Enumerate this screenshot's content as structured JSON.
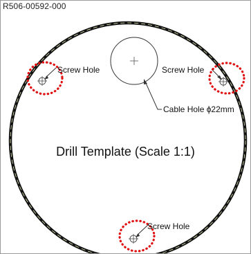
{
  "template": {
    "part_number": "R506-00592-000",
    "title": "Drill Template (Scale 1:1)"
  },
  "labels": {
    "screw_hole_left": "Screw Hole",
    "screw_hole_right": "Screw Hole",
    "screw_hole_bottom": "Screw Hole",
    "cable_hole": "Cable Hole ϕ22mm"
  },
  "colors": {
    "outer_ring": "#111111",
    "ring_dash": "#c8c8a0",
    "highlight": "#e01010",
    "line": "#333333"
  }
}
